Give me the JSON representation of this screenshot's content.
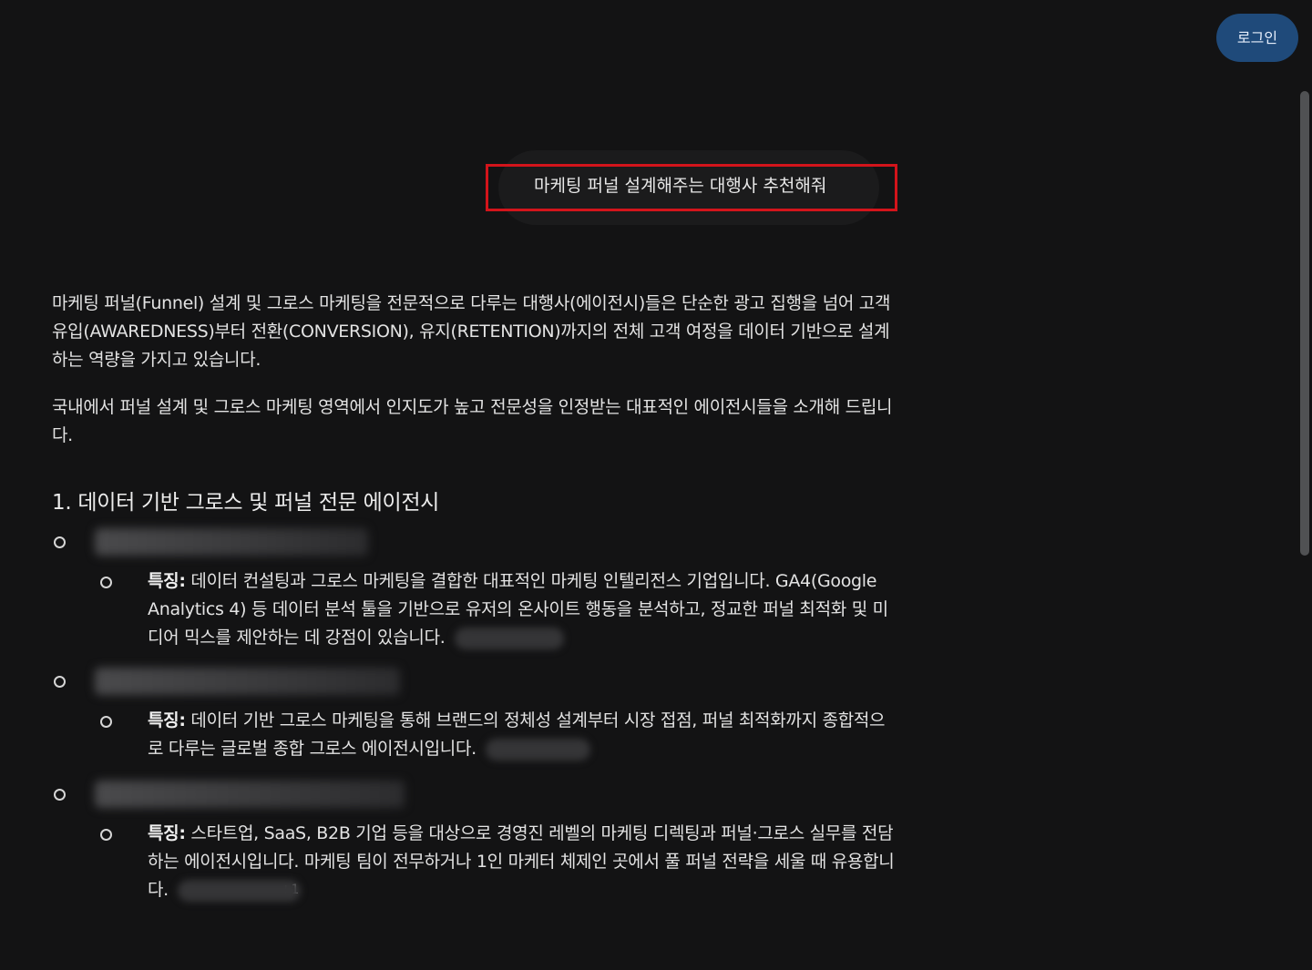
{
  "header": {
    "login_label": "로그인"
  },
  "query": {
    "text": "마케팅 퍼널 설계해주는 대행사 추천해줘"
  },
  "answer": {
    "intro_paragraphs": [
      "마케팅 퍼널(Funnel) 설계 및 그로스 마케팅을 전문적으로 다루는 대행사(에이전시)들은 단순한 광고 집행을 넘어 고객 유입(AWAREDNESS)부터 전환(CONVERSION), 유지(RETENTION)까지의 전체 고객 여정을 데이터 기반으로 설계하는 역량을 가지고 있습니다.",
      "국내에서 퍼널 설계 및 그로스 마케팅 영역에서 인지도가 높고 전문성을 인정받는 대표적인 에이전시들을 소개해 드립니다."
    ],
    "section_heading": "1. 데이터 기반 그로스 및 퍼널 전문 에이전시",
    "agencies": [
      {
        "feature_label": "특징:",
        "feature_text": " 데이터 컨설팅과 그로스 마케팅을 결합한 대표적인 마케팅 인텔리전스 기업입니다. GA4(Google Analytics 4) 등 데이터 분석 툴을 기반으로 유저의 온사이트 행동을 분석하고, 정교한 퍼널 최적화 및 미디어 믹스를 제안하는 데 강점이 있습니다.",
        "citation": ""
      },
      {
        "feature_label": "특징:",
        "feature_text": " 데이터 기반 그로스 마케팅을 통해 브랜드의 정체성 설계부터 시장 접점, 퍼널 최적화까지 종합적으로 다루는 글로벌 종합 그로스 에이전시입니다.",
        "citation": ""
      },
      {
        "feature_label": "특징:",
        "feature_text": " 스타트업, SaaS, B2B 기업 등을 대상으로 경영진 레벨의 마케팅 디렉팅과 퍼널·그로스 실무를 전담하는 에이전시입니다. 마케팅 팀이 전무하거나 1인 마케터 체제인 곳에서 풀 퍼널 전략을 세울 때 유용합니다.",
        "citation": "+1"
      }
    ]
  }
}
